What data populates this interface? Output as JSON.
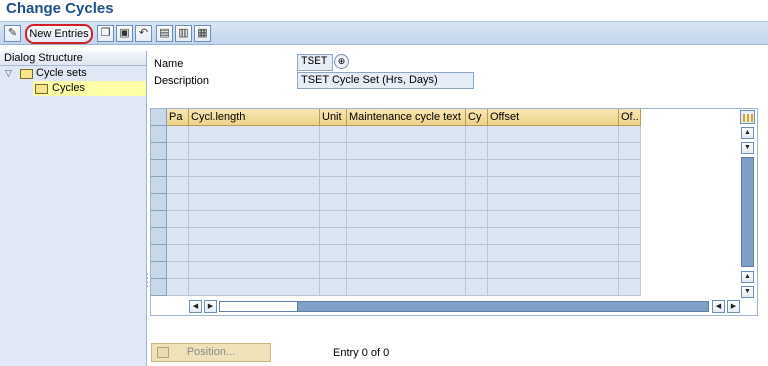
{
  "title": "Change Cycles",
  "toolbar": {
    "new_entries_label": "New Entries",
    "icons": [
      "edit-toggle-icon",
      "copy-icon",
      "delete-icon",
      "undo-icon",
      "select-all-icon",
      "select-block-icon",
      "deselect-all-icon"
    ]
  },
  "dialog_structure": {
    "header": "Dialog Structure",
    "items": [
      {
        "label": "Cycle sets",
        "expanded": true,
        "selected": false
      },
      {
        "label": "Cycles",
        "selected": true
      }
    ]
  },
  "form": {
    "name_label": "Name",
    "name_value": "TSET",
    "description_label": "Description",
    "description_value": "TSET Cycle Set (Hrs, Days)"
  },
  "table": {
    "columns": [
      "Pa",
      "Cycl.length",
      "Unit",
      "Maintenance cycle text",
      "Cy",
      "Offset",
      "Of.."
    ],
    "row_count_visible": 10,
    "rows": []
  },
  "footer": {
    "position_label": "Position...",
    "entry_text": "Entry 0 of 0"
  },
  "colors": {
    "title": "#1f4e8c",
    "toolbar_bg": "#c3d5ec",
    "header_bg": "#eed38a",
    "cell_bg": "#dce6f2",
    "highlight_border": "#d0202a",
    "selected_tree_bg": "#ffffa8"
  }
}
